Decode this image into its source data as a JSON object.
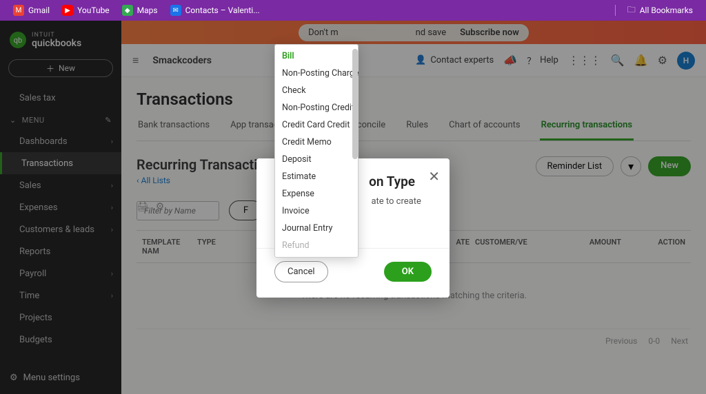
{
  "bookmarks": {
    "gmail": "Gmail",
    "youtube": "YouTube",
    "maps": "Maps",
    "contacts": "Contacts – Valenti...",
    "all": "All Bookmarks"
  },
  "promo": {
    "msg_left": "Don't m",
    "msg_right": "nd save",
    "cta": "Subscribe now"
  },
  "brand": {
    "intuit": "INTUIT",
    "product": "quickbooks"
  },
  "sidebar": {
    "new": "New",
    "sales_tax": "Sales tax",
    "menu_label": "MENU",
    "items": [
      "Dashboards",
      "Transactions",
      "Sales",
      "Expenses",
      "Customers & leads",
      "Reports",
      "Payroll",
      "Time",
      "Projects",
      "Budgets"
    ],
    "settings": "Menu settings"
  },
  "topbar": {
    "company": "Smackcoders",
    "contact": "Contact experts",
    "help": "Help",
    "avatar": "H"
  },
  "page": {
    "title": "Transactions",
    "tabs": [
      "Bank transactions",
      "App transac",
      "Reconcile",
      "Rules",
      "Chart of accounts",
      "Recurring transactions"
    ],
    "section_title": "Recurring Transactio",
    "all_lists": "All Lists",
    "reminder": "Reminder List",
    "new_btn": "New",
    "filter_placeholder": "Filter by Name",
    "filter_pill_prefix": "F",
    "cols": {
      "name": "TEMPLATE NAM",
      "type": "TYPE",
      "ate": "ATE",
      "cust": "CUSTOMER/VE",
      "amount": "AMOUNT",
      "action": "ACTION"
    },
    "empty": "There are no recurring transactions matching the criteria.",
    "pager": {
      "prev": "Previous",
      "range": "0-0",
      "next": "Next"
    }
  },
  "modal": {
    "title_suffix": "on Type",
    "label_suffix": "ate to create",
    "selected": "Bill",
    "cancel": "Cancel",
    "ok": "OK"
  },
  "dropdown": {
    "options": [
      "Bill",
      "Non-Posting Charge",
      "Check",
      "Non-Posting Credit",
      "Credit Card Credit",
      "Credit Memo",
      "Deposit",
      "Estimate",
      "Expense",
      "Invoice",
      "Journal Entry",
      "Refund"
    ]
  }
}
